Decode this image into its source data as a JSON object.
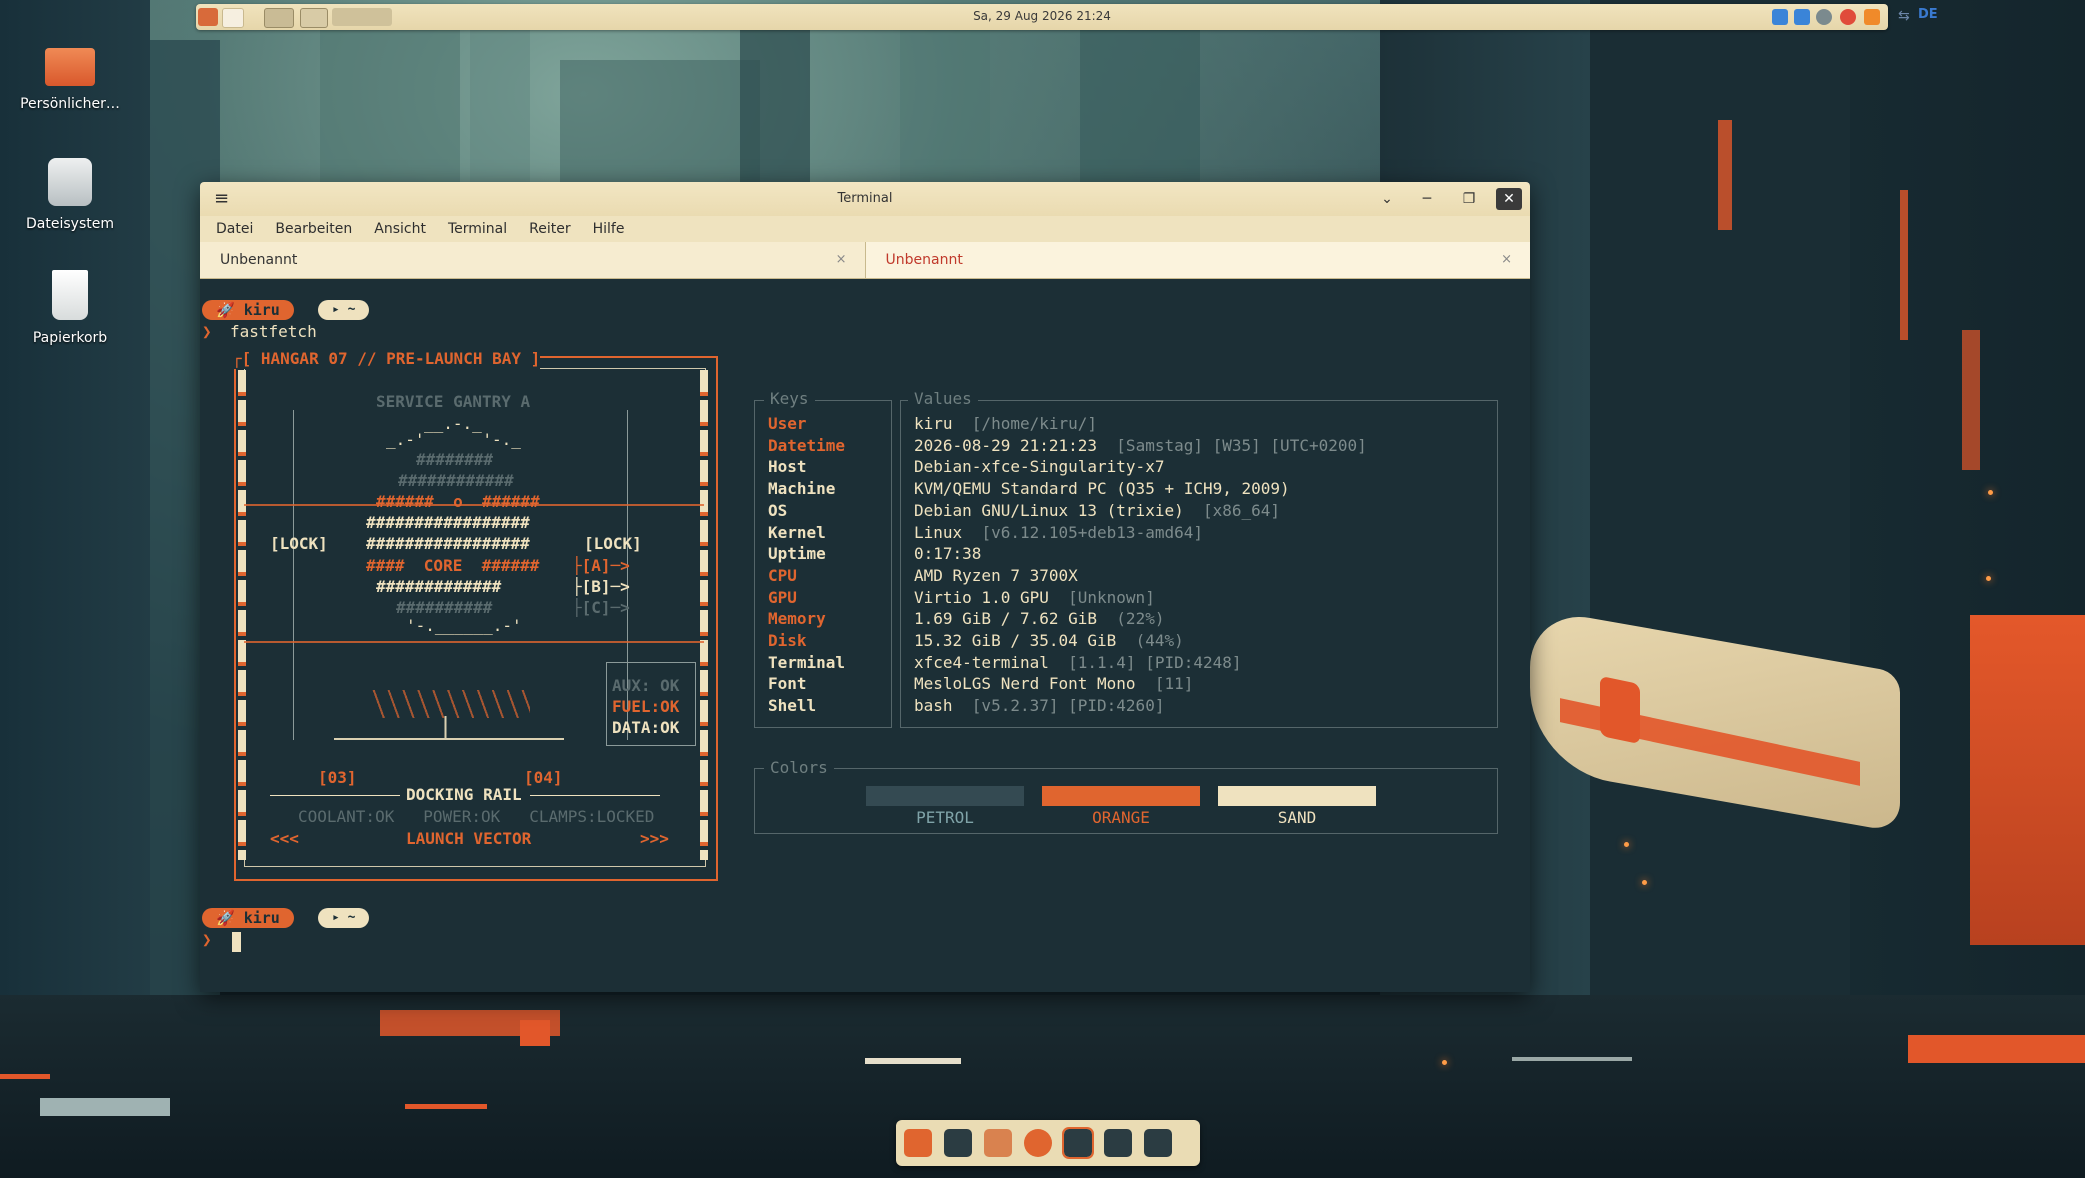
{
  "top_panel": {
    "clock": "Sa, 29 Aug 2026   21:24",
    "keyboard_layout": "DE"
  },
  "desktop_icons": [
    {
      "label": "Persönlicher…",
      "icon": "home-folder-icon"
    },
    {
      "label": "Dateisystem",
      "icon": "drive-icon"
    },
    {
      "label": "Papierkorb",
      "icon": "trash-icon"
    }
  ],
  "window": {
    "title": "Terminal",
    "menu": [
      "Datei",
      "Bearbeiten",
      "Ansicht",
      "Terminal",
      "Reiter",
      "Hilfe"
    ],
    "tabs": [
      {
        "label": "Unbenannt",
        "close": "×"
      },
      {
        "label": "Unbenannt",
        "close": "×"
      }
    ]
  },
  "prompt": {
    "user": "🚀 kiru",
    "dir": "▸ ~",
    "arrow": "❯",
    "command": "fastfetch"
  },
  "ascii": {
    "header": "┌[ HANGAR 07 // PRE-LAUNCH BAY ]",
    "gantry": "SERVICE GANTRY A",
    "lines": [
      "__.-._",
      "_.-'      '-._",
      "########",
      "############",
      "######  o  ######",
      "#################",
      "#################",
      "####  CORE  ######",
      "#############",
      "##########",
      "'-.______.-'"
    ],
    "lock_left": "[LOCK]",
    "lock_right": "[LOCK]",
    "route_a": "├[A]─>",
    "route_b": "├[B]─>",
    "route_c": "├[C]─>",
    "aux": "AUX: OK",
    "fuel": "FUEL:OK",
    "data": "DATA:OK",
    "bay3": "[03]",
    "bay4": "[04]",
    "docking": "DOCKING RAIL",
    "status": "COOLANT:OK   POWER:OK   CLAMPS:LOCKED",
    "left_arrows": "<<<",
    "vector": "LAUNCH VECTOR",
    "right_arrows": ">>>"
  },
  "info": {
    "keys_title": "Keys",
    "values_title": "Values",
    "rows": [
      {
        "key": "User",
        "value": "kiru",
        "extra": "[/home/kiru/]",
        "accent": true
      },
      {
        "key": "Datetime",
        "value": "2026-08-29 21:21:23",
        "extra": "[Samstag] [W35] [UTC+0200]",
        "accent": true
      },
      {
        "key": "Host",
        "value": "Debian-xfce-Singularity-x7",
        "extra": "",
        "accent": false
      },
      {
        "key": "Machine",
        "value": "KVM/QEMU Standard PC (Q35 + ICH9, 2009)",
        "extra": "",
        "accent": false
      },
      {
        "key": "OS",
        "value": "Debian GNU/Linux 13 (trixie)",
        "extra": "[x86_64]",
        "accent": false
      },
      {
        "key": "Kernel",
        "value": "Linux",
        "extra": "[v6.12.105+deb13-amd64]",
        "accent": false
      },
      {
        "key": "Uptime",
        "value": "0:17:38",
        "extra": "",
        "accent": false
      },
      {
        "key": "CPU",
        "value": "AMD Ryzen 7 3700X",
        "extra": "",
        "accent": true
      },
      {
        "key": "GPU",
        "value": "Virtio 1.0 GPU",
        "extra": "[Unknown]",
        "accent": true
      },
      {
        "key": "Memory",
        "value": "1.69 GiB / 7.62 GiB",
        "extra": "(22%)",
        "accent": true
      },
      {
        "key": "Disk",
        "value": "15.32 GiB / 35.04 GiB",
        "extra": "(44%)",
        "accent": true
      },
      {
        "key": "Terminal",
        "value": "xfce4-terminal",
        "extra": "[1.1.4] [PID:4248]",
        "accent": false
      },
      {
        "key": "Font",
        "value": "MesloLGS Nerd Font Mono",
        "extra": "[11]",
        "accent": false
      },
      {
        "key": "Shell",
        "value": "bash",
        "extra": "[v5.2.37] [PID:4260]",
        "accent": false
      }
    ],
    "colors_title": "Colors",
    "swatches": [
      {
        "label": "PETROL",
        "color": "#344a52",
        "text_color": "#7fa3a8"
      },
      {
        "label": "ORANGE",
        "color": "#e0652f",
        "text_color": "#e0652f"
      },
      {
        "label": "SAND",
        "color": "#efe2bf",
        "text_color": "#efe2bf"
      }
    ]
  },
  "theme": {
    "accent": "#e0652f",
    "sand": "#efe2bf",
    "petrol": "#1c2f36"
  }
}
